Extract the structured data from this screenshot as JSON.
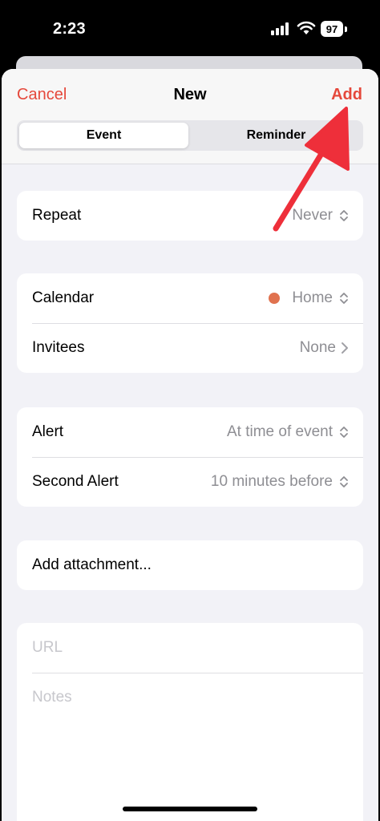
{
  "status_bar": {
    "time": "2:23",
    "battery": "97"
  },
  "nav": {
    "cancel": "Cancel",
    "title": "New",
    "add": "Add"
  },
  "segments": {
    "event": "Event",
    "reminder": "Reminder"
  },
  "repeat": {
    "label": "Repeat",
    "value": "Never"
  },
  "calendar": {
    "label": "Calendar",
    "value": "Home",
    "color": "#e0724f"
  },
  "invitees": {
    "label": "Invitees",
    "value": "None"
  },
  "alert": {
    "label": "Alert",
    "value": "At time of event"
  },
  "second_alert": {
    "label": "Second Alert",
    "value": "10 minutes before"
  },
  "attachment": {
    "label": "Add attachment..."
  },
  "url": {
    "placeholder": "URL"
  },
  "notes": {
    "placeholder": "Notes"
  },
  "colors": {
    "accent": "#e5483b",
    "annotation_arrow": "#ee2f3a"
  }
}
